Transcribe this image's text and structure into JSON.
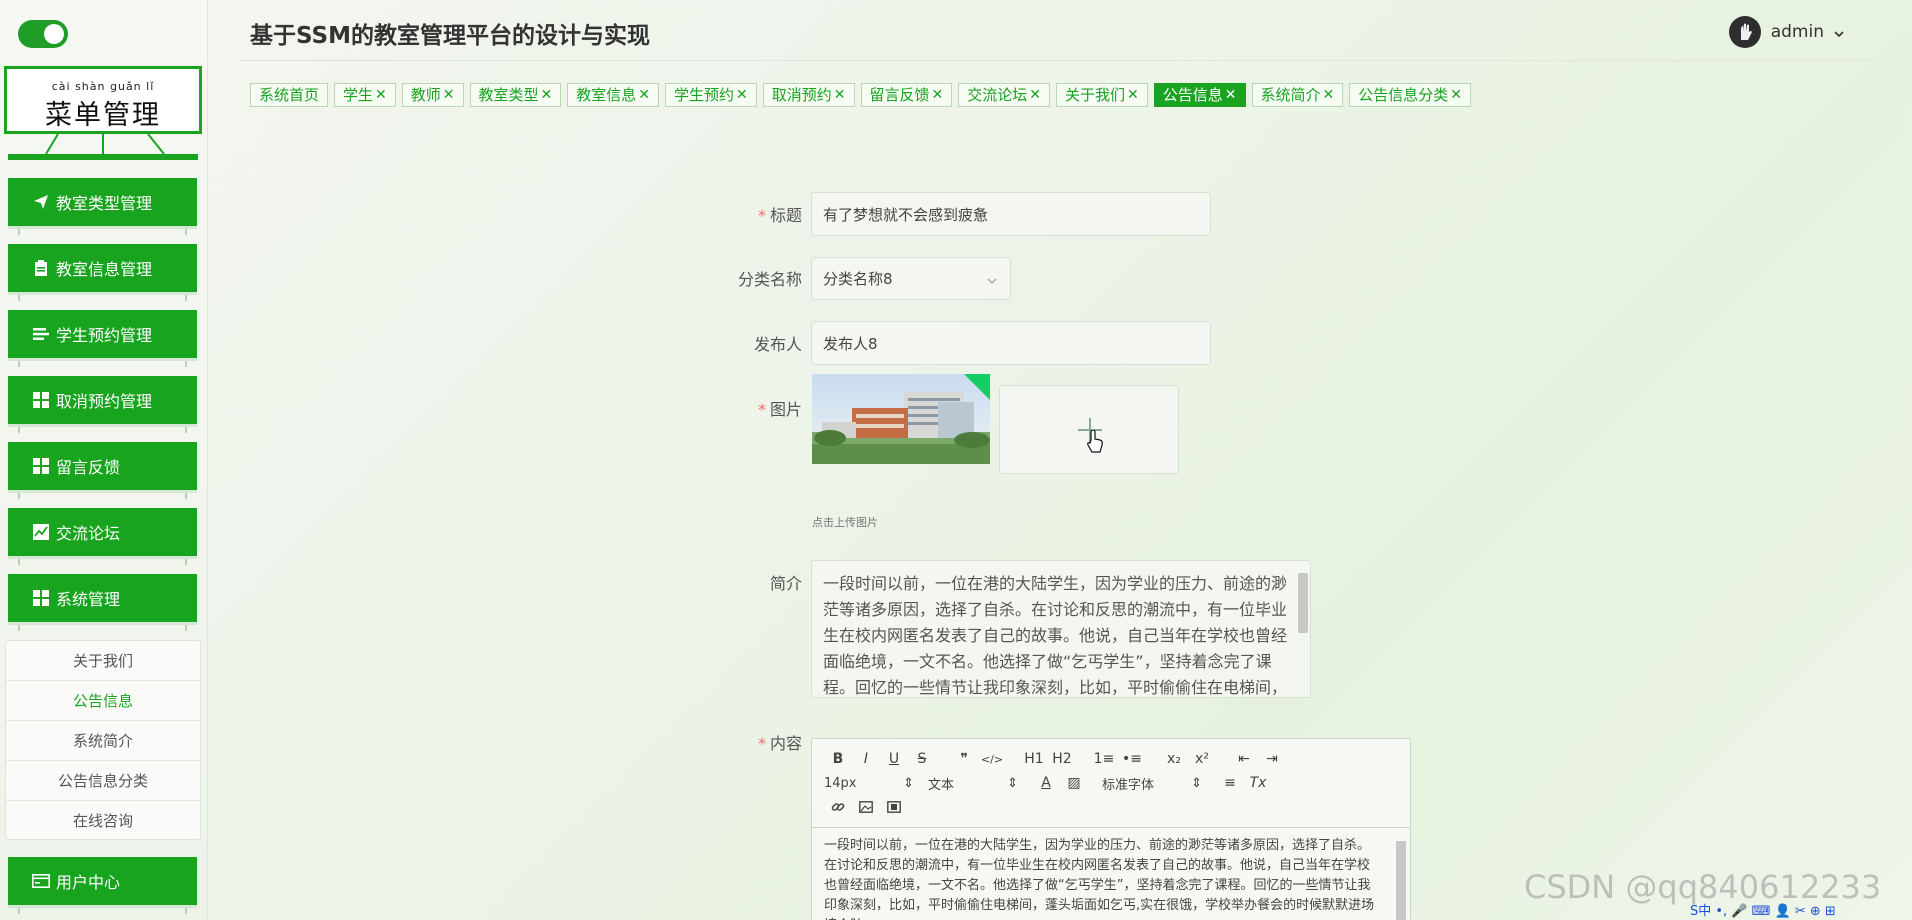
{
  "app": {
    "title": "基于SSM的教室管理平台的设计与实现",
    "user": "admin"
  },
  "sidebar": {
    "logo_pinyin": "cài shàn guǎn lǐ",
    "logo_text": "菜单管理",
    "items": [
      {
        "label": "教室类型管理",
        "icon": "paper-plane-icon"
      },
      {
        "label": "教室信息管理",
        "icon": "clipboard-icon"
      },
      {
        "label": "学生预约管理",
        "icon": "list-icon"
      },
      {
        "label": "取消预约管理",
        "icon": "grid-icon"
      },
      {
        "label": "留言反馈",
        "icon": "grid-icon"
      },
      {
        "label": "交流论坛",
        "icon": "chart-icon"
      },
      {
        "label": "系统管理",
        "icon": "grid-icon"
      }
    ],
    "submenu": [
      {
        "label": "关于我们",
        "active": false
      },
      {
        "label": "公告信息",
        "active": true
      },
      {
        "label": "系统简介",
        "active": false
      },
      {
        "label": "公告信息分类",
        "active": false
      },
      {
        "label": "在线咨询",
        "active": false
      }
    ],
    "user_center": "用户中心"
  },
  "tabs": [
    {
      "label": "系统首页",
      "closable": false,
      "active": false
    },
    {
      "label": "学生",
      "closable": true,
      "active": false
    },
    {
      "label": "教师",
      "closable": true,
      "active": false
    },
    {
      "label": "教室类型",
      "closable": true,
      "active": false
    },
    {
      "label": "教室信息",
      "closable": true,
      "active": false
    },
    {
      "label": "学生预约",
      "closable": true,
      "active": false
    },
    {
      "label": "取消预约",
      "closable": true,
      "active": false
    },
    {
      "label": "留言反馈",
      "closable": true,
      "active": false
    },
    {
      "label": "交流论坛",
      "closable": true,
      "active": false
    },
    {
      "label": "关于我们",
      "closable": true,
      "active": false
    },
    {
      "label": "公告信息",
      "closable": true,
      "active": true
    },
    {
      "label": "系统简介",
      "closable": true,
      "active": false
    },
    {
      "label": "公告信息分类",
      "closable": true,
      "active": false
    }
  ],
  "tab_close_glyph": "✕",
  "form": {
    "title_label": "标题",
    "title_value": "有了梦想就不会感到疲惫",
    "category_label": "分类名称",
    "category_value": "分类名称8",
    "publisher_label": "发布人",
    "publisher_value": "发布人8",
    "image_label": "图片",
    "upload_hint": "点击上传图片",
    "intro_label": "简介",
    "intro_text": "一段时间以前，一位在港的大陆学生，因为学业的压力、前途的渺茫等诸多原因，选择了自杀。在讨论和反思的潮流中，有一位毕业生在校内网匿名发表了自己的故事。他说，自己当年在学校也曾经面临绝境，一文不名。他选择了做“乞丐学生”，坚持着念完了课程。回忆的一些情节让我印象深刻，比如，平时偷偷住在电梯间，蓬头垢面如乞丐",
    "content_label": "内容",
    "content_text": "一段时间以前，一位在港的大陆学生，因为学业的压力、前途的渺茫等诸多原因，选择了自杀。在讨论和反思的潮流中，有一位毕业生在校内网匿名发表了自己的故事。他说，自己当年在学校也曾经面临绝境，一文不名。他选择了做“乞丐学生”，坚持着念完了课程。回忆的一些情节让我印象深刻，比如，平时偷偷住电梯间，蓬头垢面如乞丐,实在很饿，学校举办餐会的时候默默进场填个肚"
  },
  "editor": {
    "row1": [
      "B",
      "I",
      "U",
      "S",
      "❞",
      "</>",
      "H1",
      "H2",
      "1≡",
      "•≡",
      "x₂",
      "x²",
      "⇤",
      "⇥"
    ],
    "font_size": "14px",
    "block_type": "文本",
    "font_family": "标准字体",
    "clear": "Tx"
  },
  "watermark": "CSDN @qq840612233",
  "tray": "S中 •, 🎤 ⌨ 👤 ✂ ⊕ ⊞"
}
